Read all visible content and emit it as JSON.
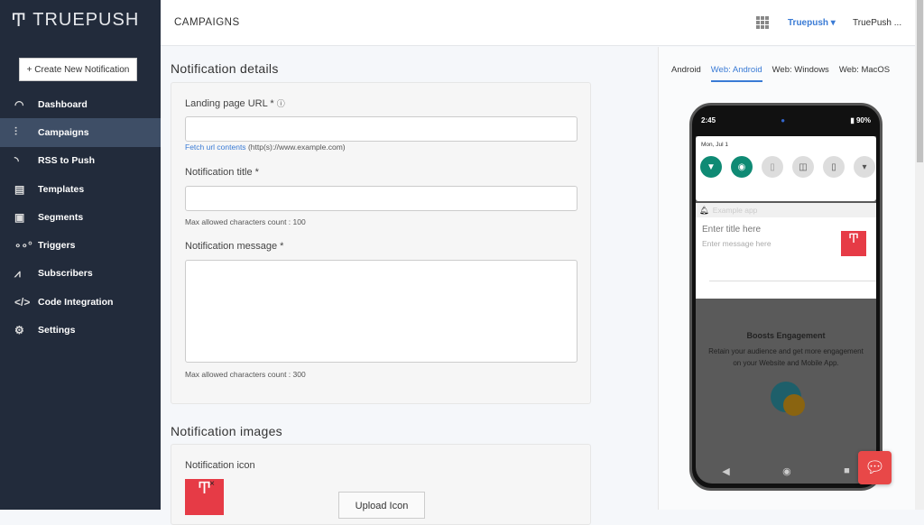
{
  "brand": "TRUEPUSH",
  "sidebar": {
    "create_button": "+ Create New Notification",
    "items": [
      {
        "label": "Dashboard",
        "icon": "gauge-icon"
      },
      {
        "label": "Campaigns",
        "icon": "sliders-icon"
      },
      {
        "label": "RSS to Push",
        "icon": "rss-icon"
      },
      {
        "label": "Templates",
        "icon": "template-icon"
      },
      {
        "label": "Segments",
        "icon": "cube-icon"
      },
      {
        "label": "Triggers",
        "icon": "triggers-icon"
      },
      {
        "label": "Subscribers",
        "icon": "subscribers-icon"
      },
      {
        "label": "Code Integration",
        "icon": "code-icon"
      },
      {
        "label": "Settings",
        "icon": "gear-icon"
      }
    ]
  },
  "header": {
    "title": "CAMPAIGNS",
    "org": "Truepush",
    "user": "TruePush ..."
  },
  "details": {
    "heading": "Notification details",
    "url_label": "Landing page URL *",
    "fetch_link": "Fetch url contents",
    "fetch_hint": "(http(s)://www.example.com)",
    "title_label": "Notification title *",
    "title_hint": "Max allowed characters count : 100",
    "message_label": "Notification message *",
    "message_hint": "Max allowed characters count : 300"
  },
  "images": {
    "heading": "Notification images",
    "icon_label": "Notification icon",
    "upload_button": "Upload Icon"
  },
  "preview": {
    "tabs": [
      "Android",
      "Web: Android",
      "Web: Windows",
      "Web: MacOS"
    ],
    "active_tab": 1,
    "time": "2:45",
    "battery": "90%",
    "date": "Mon, Jul 1",
    "app_name": "Example app",
    "title_placeholder": "Enter title here",
    "message_placeholder": "Enter message here",
    "promo_title": "Boosts Engagement",
    "promo_text": "Retain your audience and get more engagement on your Website and Mobile App."
  },
  "colors": {
    "sidebar": "#222b3b",
    "accent": "#3a7bd5",
    "brand_red": "#e84848",
    "teal": "#0f8a74"
  }
}
